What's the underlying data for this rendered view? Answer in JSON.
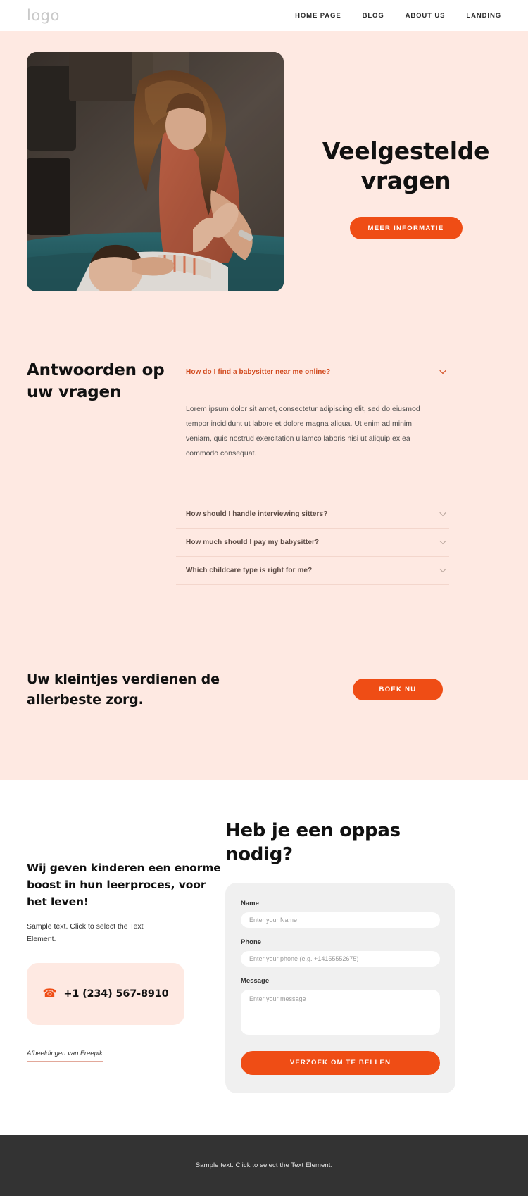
{
  "header": {
    "logo": "logo",
    "nav": [
      {
        "label": "HOME PAGE"
      },
      {
        "label": "BLOG"
      },
      {
        "label": "ABOUT US"
      },
      {
        "label": "LANDING"
      }
    ]
  },
  "hero": {
    "title": "Veelgestelde vragen",
    "cta_label": "MEER INFORMATIE",
    "image_alt": "mother-playing-with-baby-photo"
  },
  "faq": {
    "heading": "Antwoorden op uw vragen",
    "items": [
      {
        "question": "How do I find a babysitter near me online?",
        "answer": "Lorem ipsum dolor sit amet, consectetur adipiscing elit, sed do eiusmod tempor incididunt ut labore et dolore magna aliqua. Ut enim ad minim veniam, quis nostrud exercitation ullamco laboris nisi ut aliquip ex ea commodo consequat.",
        "open": true
      },
      {
        "question": "How should I handle interviewing sitters?",
        "answer": "",
        "open": false
      },
      {
        "question": "How much should I pay my babysitter?",
        "answer": "",
        "open": false
      },
      {
        "question": "Which childcare type is right for me?",
        "answer": "",
        "open": false
      }
    ]
  },
  "cta": {
    "text": "Uw kleintjes verdienen de allerbeste zorg.",
    "button_label": "BOEK NU"
  },
  "contact": {
    "heading": "Wij geven kinderen een enorme boost in hun leerproces, voor het leven!",
    "subtext": "Sample text. Click to select the Text Element.",
    "phone": "+1 (234) 567-8910",
    "credit": "Afbeeldingen van Freepik",
    "form": {
      "heading": "Heb je een oppas nodig?",
      "name_label": "Name",
      "name_placeholder": "Enter your Name",
      "name_value": "",
      "phone_label": "Phone",
      "phone_placeholder": "Enter your phone (e.g. +14155552675)",
      "phone_value": "",
      "message_label": "Message",
      "message_placeholder": "Enter your message",
      "message_value": "",
      "submit_label": "VERZOEK OM TE BELLEN"
    }
  },
  "footer": {
    "text": "Sample text. Click to select the Text Element."
  },
  "colors": {
    "accent": "#ef4d15",
    "hero_bg": "#fee9e2",
    "footer_bg": "#333333",
    "form_bg": "#f0f0f0",
    "faq_open": "#d14a1e"
  }
}
